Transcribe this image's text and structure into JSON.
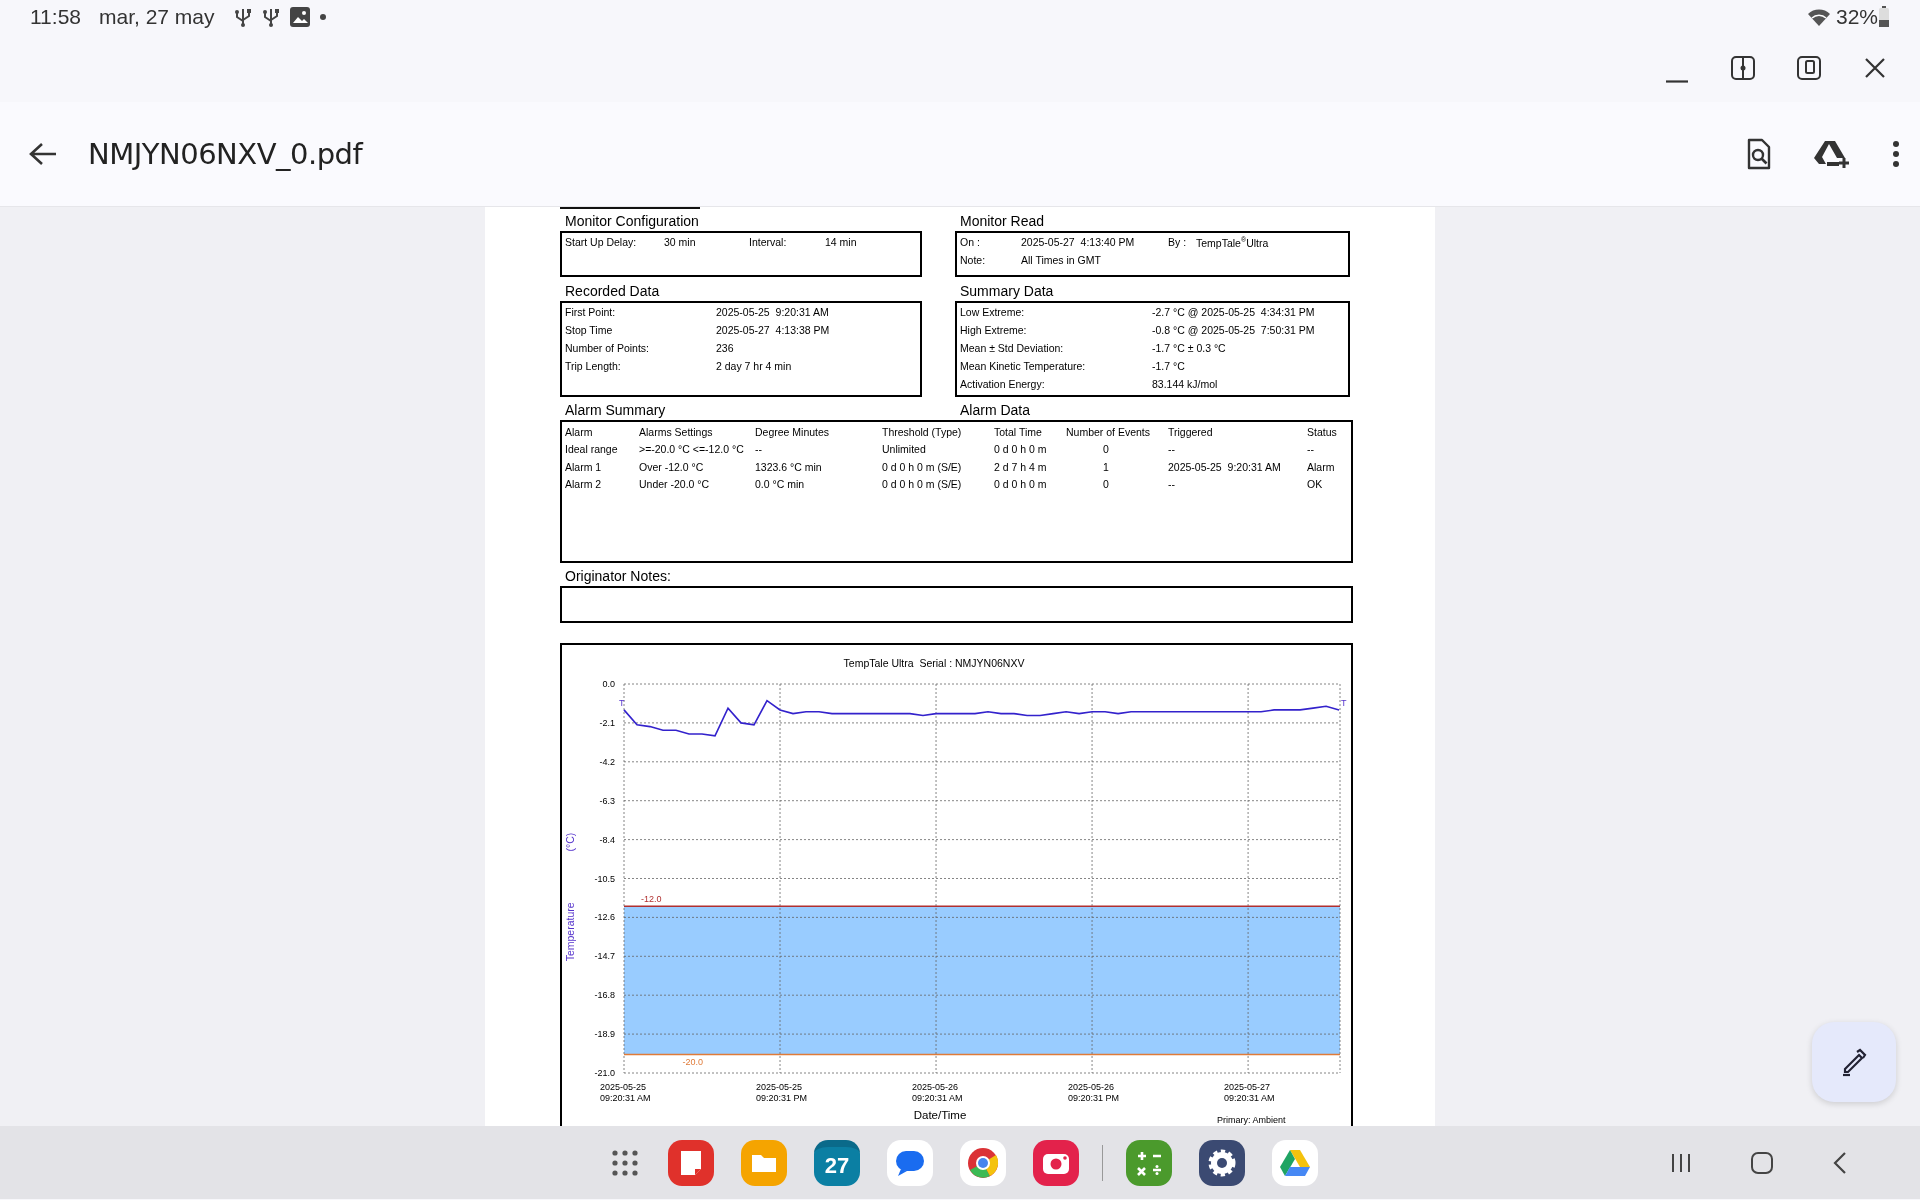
{
  "status_bar": {
    "time": "11:58",
    "date": "mar, 27 may",
    "battery": "32%"
  },
  "app_bar": {
    "title": "NMJYN06NXV_0.pdf"
  },
  "report": {
    "monitor_configuration": {
      "title": "Monitor Configuration",
      "rows": [
        [
          "Start Up Delay:",
          "30 min",
          "Interval:",
          "14 min"
        ]
      ]
    },
    "monitor_read": {
      "title": "Monitor Read",
      "rows": [
        [
          "On :",
          "2025-05-27  4:13:40 PM",
          "By :",
          "TempTale$^{®}$Ultra"
        ],
        [
          "Note:",
          "All Times in GMT"
        ]
      ]
    },
    "recorded_data": {
      "title": "Recorded Data",
      "rows": [
        [
          "First Point:",
          "2025-05-25  9:20:31 AM"
        ],
        [
          "Stop Time",
          "2025-05-27  4:13:38 PM"
        ],
        [
          "Number of Points:",
          "236"
        ],
        [
          "Trip Length:",
          "2 day 7 hr 4 min"
        ]
      ]
    },
    "summary_data": {
      "title": "Summary Data",
      "rows": [
        [
          "Low Extreme:",
          "-2.7 °C @ 2025-05-25  4:34:31 PM"
        ],
        [
          "High Extreme:",
          "-0.8 °C @ 2025-05-25  7:50:31 PM"
        ],
        [
          "Mean ± Std Deviation:",
          "-1.7 °C ± 0.3 °C"
        ],
        [
          "Mean Kinetic Temperature:",
          "-1.7 °C"
        ],
        [
          "Activation Energy:",
          "83.144 kJ/mol"
        ]
      ]
    },
    "alarm_summary": {
      "title": "Alarm Summary"
    },
    "alarm_data": {
      "title": "Alarm Data",
      "columns": [
        "Alarm",
        "Alarms Settings",
        "Degree Minutes",
        "Threshold (Type)",
        "Total Time",
        "Number of Events",
        "Triggered",
        "Status"
      ],
      "rows": [
        [
          "Ideal range",
          ">=-20.0 °C <=-12.0 °C",
          "--",
          "Unlimited",
          "0 d 0 h 0 m",
          "0",
          "--",
          "--"
        ],
        [
          "Alarm 1",
          "Over -12.0 °C",
          "1323.6 °C min",
          "0 d 0 h 0 m (S/E)",
          "2 d 7 h 4 m",
          "1",
          "2025-05-25  9:20:31 AM",
          "Alarm"
        ],
        [
          "Alarm 2",
          "Under -20.0 °C",
          "0.0 °C min",
          "0 d 0 h 0 m (S/E)",
          "0 d 0 h 0 m",
          "0",
          "--",
          "OK"
        ]
      ]
    },
    "originator_notes": {
      "title": "Originator Notes:"
    },
    "chart": {
      "legend": "Primary: Ambient",
      "chart_data": {
        "type": "line",
        "title": "TempTale Ultra  Serial : NMJYN06NXV",
        "xlabel": "Date/Time",
        "ylabel": "Temperature (°C)",
        "categories": [
          "2025-05-25 09:20:31 AM",
          null,
          null,
          null,
          null,
          null,
          null,
          null,
          null,
          null,
          null,
          null,
          "2025-05-25 09:20:31 PM",
          null,
          null,
          null,
          null,
          null,
          null,
          null,
          null,
          null,
          null,
          null,
          "2025-05-26 09:20:31 AM",
          null,
          null,
          null,
          null,
          null,
          null,
          null,
          null,
          null,
          null,
          null,
          "2025-05-26 09:20:31 PM",
          null,
          null,
          null,
          null,
          null,
          null,
          null,
          null,
          null,
          null,
          null,
          "2025-05-27 09:20:31 AM",
          null,
          null,
          null,
          null,
          null,
          null,
          null
        ],
        "series": [
          {
            "color": "#3322cc",
            "values": [
              -1.4,
              -2.2,
              -2.3,
              -2.5,
              -2.5,
              -2.7,
              -2.7,
              -2.8,
              -1.3,
              -2.1,
              -2.2,
              -0.9,
              -1.4,
              -1.6,
              -1.5,
              -1.5,
              -1.6,
              -1.6,
              -1.6,
              -1.6,
              -1.6,
              -1.6,
              -1.6,
              -1.7,
              -1.6,
              -1.6,
              -1.6,
              -1.6,
              -1.5,
              -1.6,
              -1.6,
              -1.7,
              -1.7,
              -1.6,
              -1.5,
              -1.6,
              -1.5,
              -1.5,
              -1.6,
              -1.5,
              -1.5,
              -1.5,
              -1.5,
              -1.5,
              -1.5,
              -1.5,
              -1.5,
              -1.5,
              -1.5,
              -1.5,
              -1.4,
              -1.4,
              -1.4,
              -1.3,
              -1.2,
              -1.4
            ]
          }
        ],
        "ylim": [
          -21,
          0
        ],
        "yticks": [
          {
            "value": 0,
            "label": "0.0"
          },
          {
            "value": -2.1,
            "label": "-2.1"
          },
          {
            "value": -4.2,
            "label": "-4.2"
          },
          {
            "value": -6.3,
            "label": "-6.3"
          },
          {
            "value": -8.4,
            "label": "-8.4"
          },
          {
            "value": -10.5,
            "label": "-10.5"
          },
          {
            "value": -12.6,
            "label": "-12.6"
          },
          {
            "value": -14.7,
            "label": "-14.7"
          },
          {
            "value": -16.8,
            "label": "-16.8"
          },
          {
            "value": -18.9,
            "label": "-18.9"
          },
          {
            "value": -21,
            "label": "-21.0"
          }
        ],
        "grid": true,
        "bands": [
          {
            "axis": "y",
            "from": -20,
            "to": -12,
            "color": "#99ccff"
          }
        ],
        "ref_lines": [
          {
            "axis": "y",
            "value": -12,
            "label": "-12.0",
            "color": "#b03030"
          },
          {
            "axis": "y",
            "value": -20,
            "label": "-20.0",
            "color": "#e07b39"
          }
        ],
        "annotations": [
          {
            "text": "T"
          },
          {
            "text": "T"
          }
        ]
      }
    }
  },
  "dock": {
    "calendar_day": "27"
  }
}
